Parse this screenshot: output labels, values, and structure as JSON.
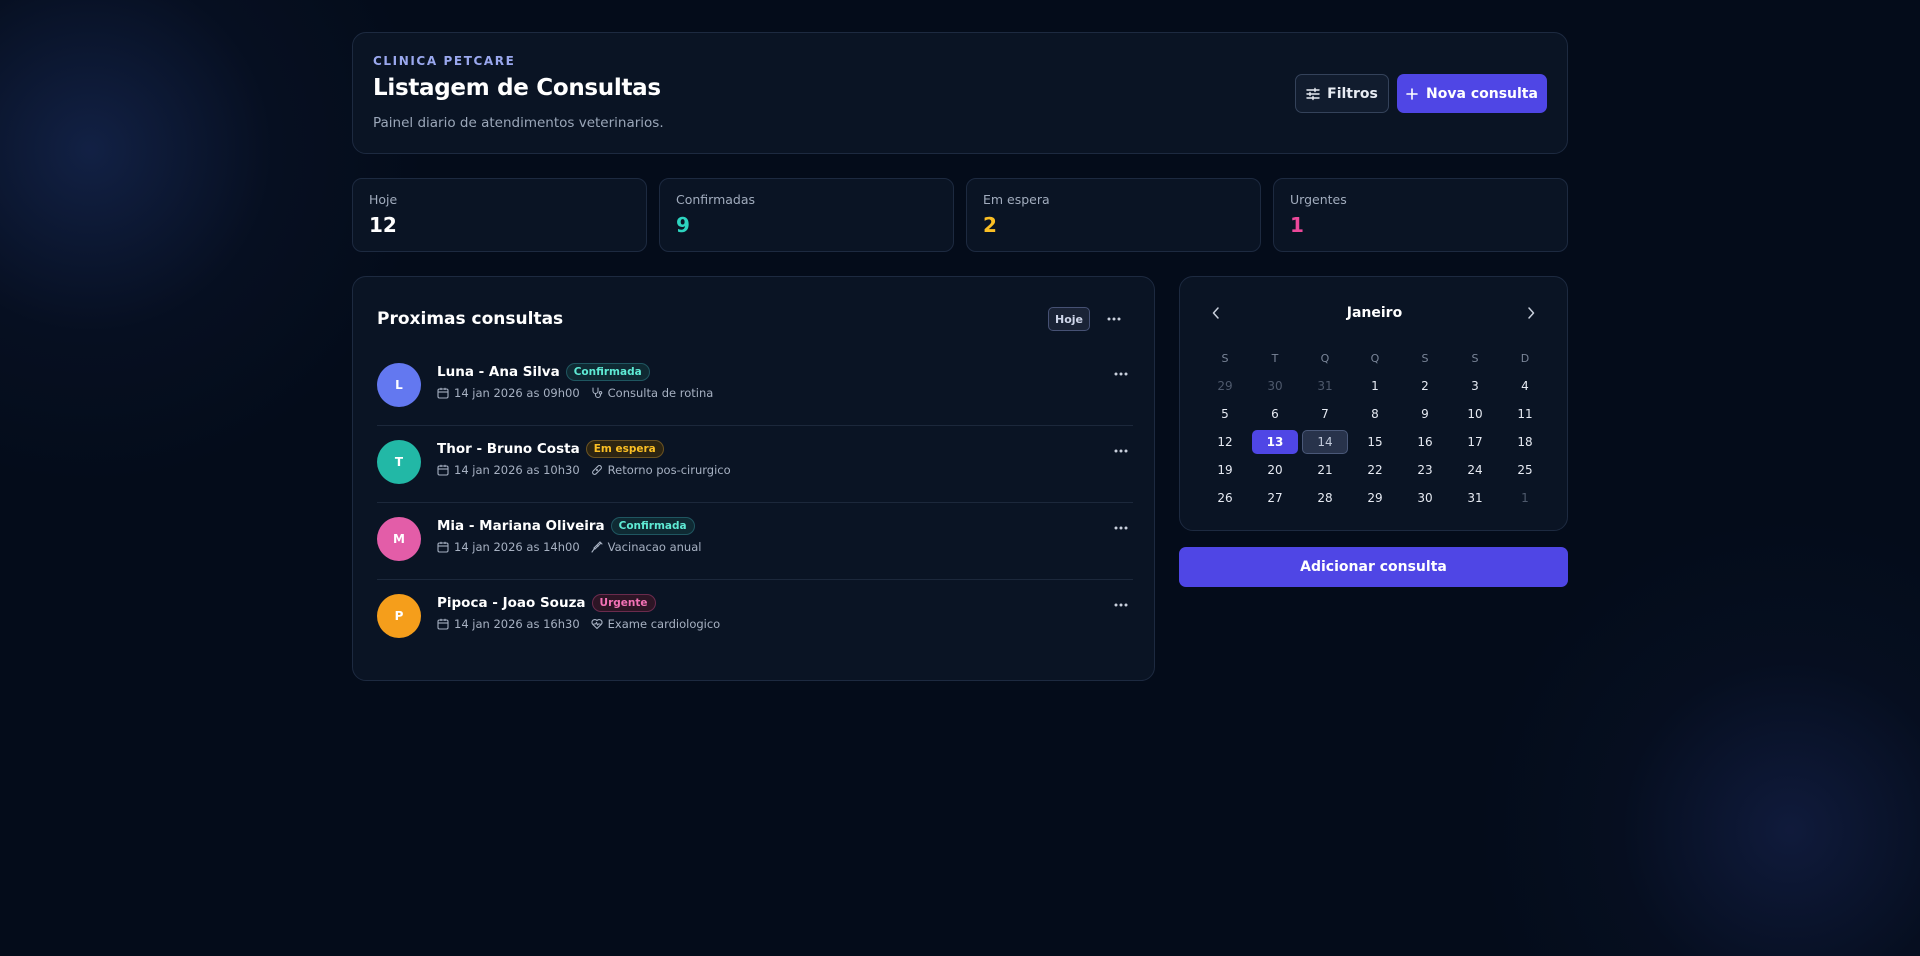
{
  "header": {
    "eyebrow": "CLINICA PETCARE",
    "title": "Listagem de Consultas",
    "subtitle": "Painel diario de atendimentos veterinarios.",
    "filters_label": "Filtros",
    "new_label": "Nova consulta"
  },
  "stats": [
    {
      "label": "Hoje",
      "value": "12",
      "color": "#ffffff"
    },
    {
      "label": "Confirmadas",
      "value": "9",
      "color": "#2dd4bf"
    },
    {
      "label": "Em espera",
      "value": "2",
      "color": "#fbbf24"
    },
    {
      "label": "Urgentes",
      "value": "1",
      "color": "#ec4899"
    }
  ],
  "appointments": {
    "title": "Proximas consultas",
    "filter_pill": "Hoje",
    "items": [
      {
        "initial": "L",
        "name": "Luna - Ana Silva",
        "status": "Confirmada",
        "datetime": "14 jan 2026 as 09h00",
        "service": "Consulta de rotina",
        "service_icon": "stethoscope-icon",
        "avatar_color": "#6378f0"
      },
      {
        "initial": "T",
        "name": "Thor - Bruno Costa",
        "status": "Em espera",
        "datetime": "14 jan 2026 as 10h30",
        "service": "Retorno pos-cirurgico",
        "service_icon": "bandage-icon",
        "avatar_color": "#22b8a6"
      },
      {
        "initial": "M",
        "name": "Mia - Mariana Oliveira",
        "status": "Confirmada",
        "datetime": "14 jan 2026 as 14h00",
        "service": "Vacinacao anual",
        "service_icon": "syringe-icon",
        "avatar_color": "#e35da8"
      },
      {
        "initial": "P",
        "name": "Pipoca - Joao Souza",
        "status": "Urgente",
        "datetime": "14 jan 2026 as 16h30",
        "service": "Exame cardiologico",
        "service_icon": "heart-pulse-icon",
        "avatar_color": "#f59e1b"
      }
    ]
  },
  "status_colors": {
    "Confirmada": {
      "text": "#5eead4",
      "bg": "#0f2a33",
      "border": "#1f5660"
    },
    "Em espera": {
      "text": "#fbbf24",
      "bg": "#2d2512",
      "border": "#6b5321"
    },
    "Urgente": {
      "text": "#f472b6",
      "bg": "#2d1525",
      "border": "#6b2b4d"
    }
  },
  "calendar": {
    "month": "Janeiro",
    "weekdays": [
      "S",
      "T",
      "Q",
      "Q",
      "S",
      "S",
      "D"
    ],
    "weeks": [
      [
        {
          "d": "29",
          "muted": true
        },
        {
          "d": "30",
          "muted": true
        },
        {
          "d": "31",
          "muted": true
        },
        {
          "d": "1"
        },
        {
          "d": "2"
        },
        {
          "d": "3"
        },
        {
          "d": "4"
        }
      ],
      [
        {
          "d": "5"
        },
        {
          "d": "6"
        },
        {
          "d": "7"
        },
        {
          "d": "8"
        },
        {
          "d": "9"
        },
        {
          "d": "10"
        },
        {
          "d": "11"
        }
      ],
      [
        {
          "d": "12"
        },
        {
          "d": "13",
          "today": true
        },
        {
          "d": "14",
          "selected": true
        },
        {
          "d": "15"
        },
        {
          "d": "16"
        },
        {
          "d": "17"
        },
        {
          "d": "18"
        }
      ],
      [
        {
          "d": "19"
        },
        {
          "d": "20"
        },
        {
          "d": "21"
        },
        {
          "d": "22"
        },
        {
          "d": "23"
        },
        {
          "d": "24"
        },
        {
          "d": "25"
        }
      ],
      [
        {
          "d": "26"
        },
        {
          "d": "27"
        },
        {
          "d": "28"
        },
        {
          "d": "29"
        },
        {
          "d": "30"
        },
        {
          "d": "31"
        },
        {
          "d": "1",
          "muted": true
        }
      ]
    ]
  },
  "add_button": "Adicionar consulta"
}
